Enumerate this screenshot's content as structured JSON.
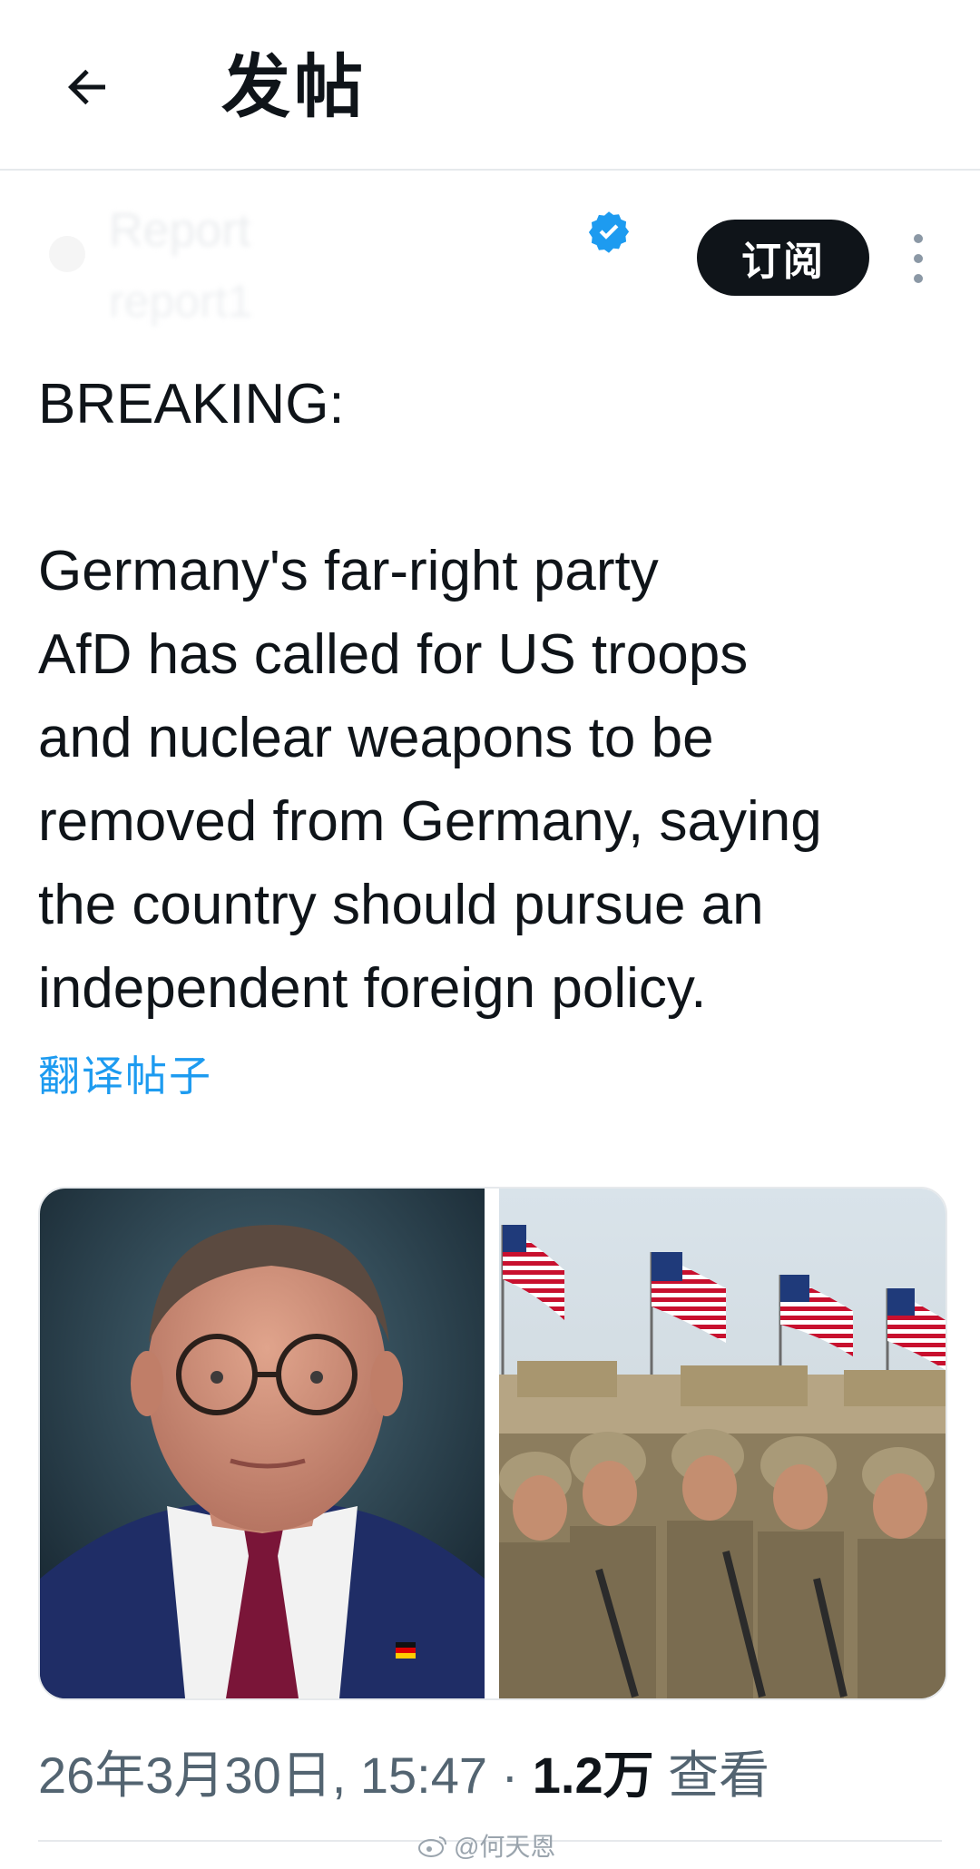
{
  "header": {
    "title": "发帖",
    "back_icon": "arrow-left-icon"
  },
  "author": {
    "name": "Report",
    "handle": "report1",
    "verified": true,
    "verified_color": "#1d9bf0",
    "subscribe_label": "订阅",
    "more_icon": "more-vertical-icon"
  },
  "tweet": {
    "lines": [
      "BREAKING:",
      "",
      "Germany's far-right party",
      "AfD has called for US troops",
      "and nuclear weapons to be",
      "removed from Germany, saying",
      "the country should pursue an",
      "independent foreign policy."
    ],
    "translate_label": "翻译帖子",
    "link_color": "#1d9bf0"
  },
  "media": [
    {
      "name": "portrait-photo",
      "description_icon": "person-photo"
    },
    {
      "name": "soldiers-photo",
      "description_icon": "soldiers-flags-photo"
    }
  ],
  "meta": {
    "timestamp": "26年3月30日, 15:47 · ",
    "views_count": "1.2万",
    "views_label": " 查看"
  },
  "watermark": {
    "text": "@何天恩",
    "icon": "weibo-icon"
  }
}
